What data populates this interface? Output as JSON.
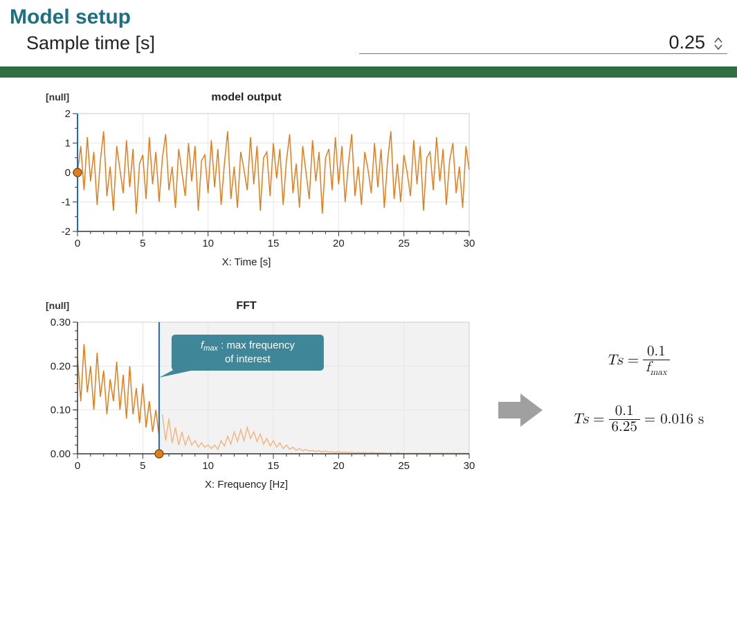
{
  "panel": {
    "title": "Model setup",
    "param_label": "Sample time [s]",
    "param_value": "0.25"
  },
  "formulas": {
    "f1_lhs": "Ts",
    "f1_num": "0.1",
    "f1_den_sym": "f",
    "f1_den_sub": "max",
    "f2_lhs": "Ts",
    "f2_num": "0.1",
    "f2_den": "6.25",
    "f2_rhs": "= 0.016 s"
  },
  "callout": {
    "line1_prefix_sym": "f",
    "line1_prefix_sub": "max",
    "line1_rest": " : max frequency",
    "line2": "of interest"
  },
  "chart_data": [
    {
      "type": "line",
      "id": "model_output",
      "title": "model output",
      "xlabel": "X: Time [s]",
      "ylabel": "[null]",
      "xlim": [
        0,
        30
      ],
      "ylim": [
        -2,
        2
      ],
      "y_ticks": [
        -2,
        -1,
        0,
        1,
        2
      ],
      "x_ticks": [
        0,
        5,
        10,
        15,
        20,
        25,
        30
      ],
      "cursor_x": 0,
      "marker": {
        "x": 0,
        "y": 0
      },
      "x": [
        0,
        0.25,
        0.5,
        0.75,
        1,
        1.25,
        1.5,
        1.75,
        2,
        2.25,
        2.5,
        2.75,
        3,
        3.25,
        3.5,
        3.75,
        4,
        4.25,
        4.5,
        4.75,
        5,
        5.25,
        5.5,
        5.75,
        6,
        6.25,
        6.5,
        6.75,
        7,
        7.25,
        7.5,
        7.75,
        8,
        8.25,
        8.5,
        8.75,
        9,
        9.25,
        9.5,
        9.75,
        10,
        10.25,
        10.5,
        10.75,
        11,
        11.25,
        11.5,
        11.75,
        12,
        12.25,
        12.5,
        12.75,
        13,
        13.25,
        13.5,
        13.75,
        14,
        14.25,
        14.5,
        14.75,
        15,
        15.25,
        15.5,
        15.75,
        16,
        16.25,
        16.5,
        16.75,
        17,
        17.25,
        17.5,
        17.75,
        18,
        18.25,
        18.5,
        18.75,
        19,
        19.25,
        19.5,
        19.75,
        20,
        20.25,
        20.5,
        20.75,
        21,
        21.25,
        21.5,
        21.75,
        22,
        22.25,
        22.5,
        22.75,
        23,
        23.25,
        23.5,
        23.75,
        24,
        24.25,
        24.5,
        24.75,
        25,
        25.25,
        25.5,
        25.75,
        26,
        26.25,
        26.5,
        26.75,
        27,
        27.25,
        27.5,
        27.75,
        28,
        28.25,
        28.5,
        28.75,
        29,
        29.25,
        29.5,
        29.75,
        30
      ],
      "values": [
        0,
        0.9,
        -0.6,
        1.2,
        -0.3,
        0.7,
        -1.1,
        0.4,
        1.4,
        -0.8,
        0.2,
        -1.3,
        0.9,
        0.1,
        -0.7,
        1.1,
        -0.5,
        0.8,
        -1.4,
        0.3,
        0.6,
        -0.9,
        1.2,
        -0.4,
        0.7,
        -1.0,
        0.5,
        1.3,
        -0.6,
        0.2,
        -1.2,
        0.8,
        0.0,
        -0.8,
        1.0,
        -0.3,
        0.9,
        -1.3,
        0.4,
        0.6,
        -0.7,
        1.1,
        -0.5,
        0.8,
        -1.1,
        0.3,
        1.4,
        -0.9,
        0.2,
        -1.2,
        0.7,
        0.1,
        -0.6,
        1.2,
        -0.4,
        0.9,
        -1.3,
        0.5,
        0.7,
        -0.8,
        1.0,
        -0.2,
        0.8,
        -1.1,
        0.4,
        1.3,
        -0.7,
        0.3,
        -1.2,
        0.9,
        0.0,
        -0.9,
        1.1,
        -0.3,
        0.7,
        -1.4,
        0.5,
        0.8,
        -0.6,
        1.2,
        -0.4,
        0.9,
        -1.0,
        0.3,
        1.3,
        -0.8,
        0.2,
        -1.1,
        0.7,
        0.1,
        -0.7,
        1.0,
        -0.5,
        0.8,
        -1.2,
        0.4,
        1.4,
        -0.9,
        0.3,
        -1.0,
        0.6,
        0.0,
        -0.8,
        1.1,
        -0.4,
        0.9,
        -1.3,
        0.5,
        0.7,
        -0.6,
        1.2,
        -0.3,
        0.8,
        -1.1,
        0.4,
        1.0,
        -0.7,
        0.2,
        -1.2,
        0.9,
        0.1
      ]
    },
    {
      "type": "line",
      "id": "fft",
      "title": "FFT",
      "xlabel": "X: Frequency [Hz]",
      "ylabel": "[null]",
      "xlim": [
        0,
        30
      ],
      "ylim": [
        0,
        0.3
      ],
      "y_ticks": [
        0.0,
        0.1,
        0.2,
        0.3
      ],
      "x_ticks": [
        0,
        5,
        10,
        15,
        20,
        25,
        30
      ],
      "cursor_x": 6.25,
      "marker": {
        "x": 6.25,
        "y": 0.0
      },
      "shaded_region": [
        6.25,
        30
      ],
      "x": [
        0,
        0.25,
        0.5,
        0.75,
        1,
        1.25,
        1.5,
        1.75,
        2,
        2.25,
        2.5,
        2.75,
        3,
        3.25,
        3.5,
        3.75,
        4,
        4.25,
        4.5,
        4.75,
        5,
        5.25,
        5.5,
        5.75,
        6,
        6.25,
        6.5,
        6.75,
        7,
        7.25,
        7.5,
        7.75,
        8,
        8.25,
        8.5,
        8.75,
        9,
        9.25,
        9.5,
        9.75,
        10,
        10.25,
        10.5,
        10.75,
        11,
        11.25,
        11.5,
        11.75,
        12,
        12.25,
        12.5,
        12.75,
        13,
        13.25,
        13.5,
        13.75,
        14,
        14.25,
        14.5,
        14.75,
        15,
        15.25,
        15.5,
        15.75,
        16,
        16.25,
        16.5,
        16.75,
        17,
        17.25,
        17.5,
        17.75,
        18,
        18.25,
        18.5,
        18.75,
        19,
        19.25,
        19.5,
        19.75,
        20,
        20.25,
        20.5,
        20.75,
        21,
        21.25,
        21.5,
        21.75,
        22,
        22.25,
        22.5,
        22.75,
        23,
        23.25,
        23.5,
        23.75,
        24,
        24.25,
        24.5,
        24.75,
        25,
        25.25,
        25.5,
        25.75,
        26,
        26.25,
        26.5,
        26.75,
        27,
        27.25,
        27.5,
        27.75,
        28,
        28.25,
        28.5,
        28.75,
        29,
        29.25,
        29.5,
        29.75,
        30
      ],
      "values": [
        0.22,
        0.12,
        0.25,
        0.14,
        0.2,
        0.1,
        0.23,
        0.13,
        0.19,
        0.09,
        0.17,
        0.12,
        0.21,
        0.1,
        0.18,
        0.08,
        0.2,
        0.09,
        0.15,
        0.07,
        0.16,
        0.06,
        0.12,
        0.05,
        0.1,
        0.04,
        0.09,
        0.03,
        0.08,
        0.025,
        0.06,
        0.02,
        0.05,
        0.02,
        0.04,
        0.02,
        0.03,
        0.015,
        0.025,
        0.015,
        0.02,
        0.012,
        0.02,
        0.01,
        0.03,
        0.018,
        0.04,
        0.022,
        0.05,
        0.028,
        0.055,
        0.03,
        0.06,
        0.035,
        0.05,
        0.028,
        0.045,
        0.022,
        0.035,
        0.018,
        0.03,
        0.015,
        0.025,
        0.012,
        0.02,
        0.01,
        0.015,
        0.008,
        0.012,
        0.007,
        0.01,
        0.006,
        0.008,
        0.005,
        0.007,
        0.004,
        0.006,
        0.004,
        0.005,
        0.003,
        0.005,
        0.003,
        0.004,
        0.003,
        0.004,
        0.002,
        0.003,
        0.002,
        0.003,
        0.002,
        0.003,
        0.002,
        0.002,
        0.002,
        0.002,
        0.001,
        0.002,
        0.001,
        0.002,
        0.001,
        0.001,
        0.001,
        0.001,
        0.001,
        0.001,
        0.001,
        0.001,
        0.001,
        0.001,
        0.001,
        0.001,
        0.001,
        0.001,
        0.001,
        0.001,
        0.001,
        0.001,
        0.001,
        0.001,
        0.001,
        0.001
      ]
    }
  ]
}
